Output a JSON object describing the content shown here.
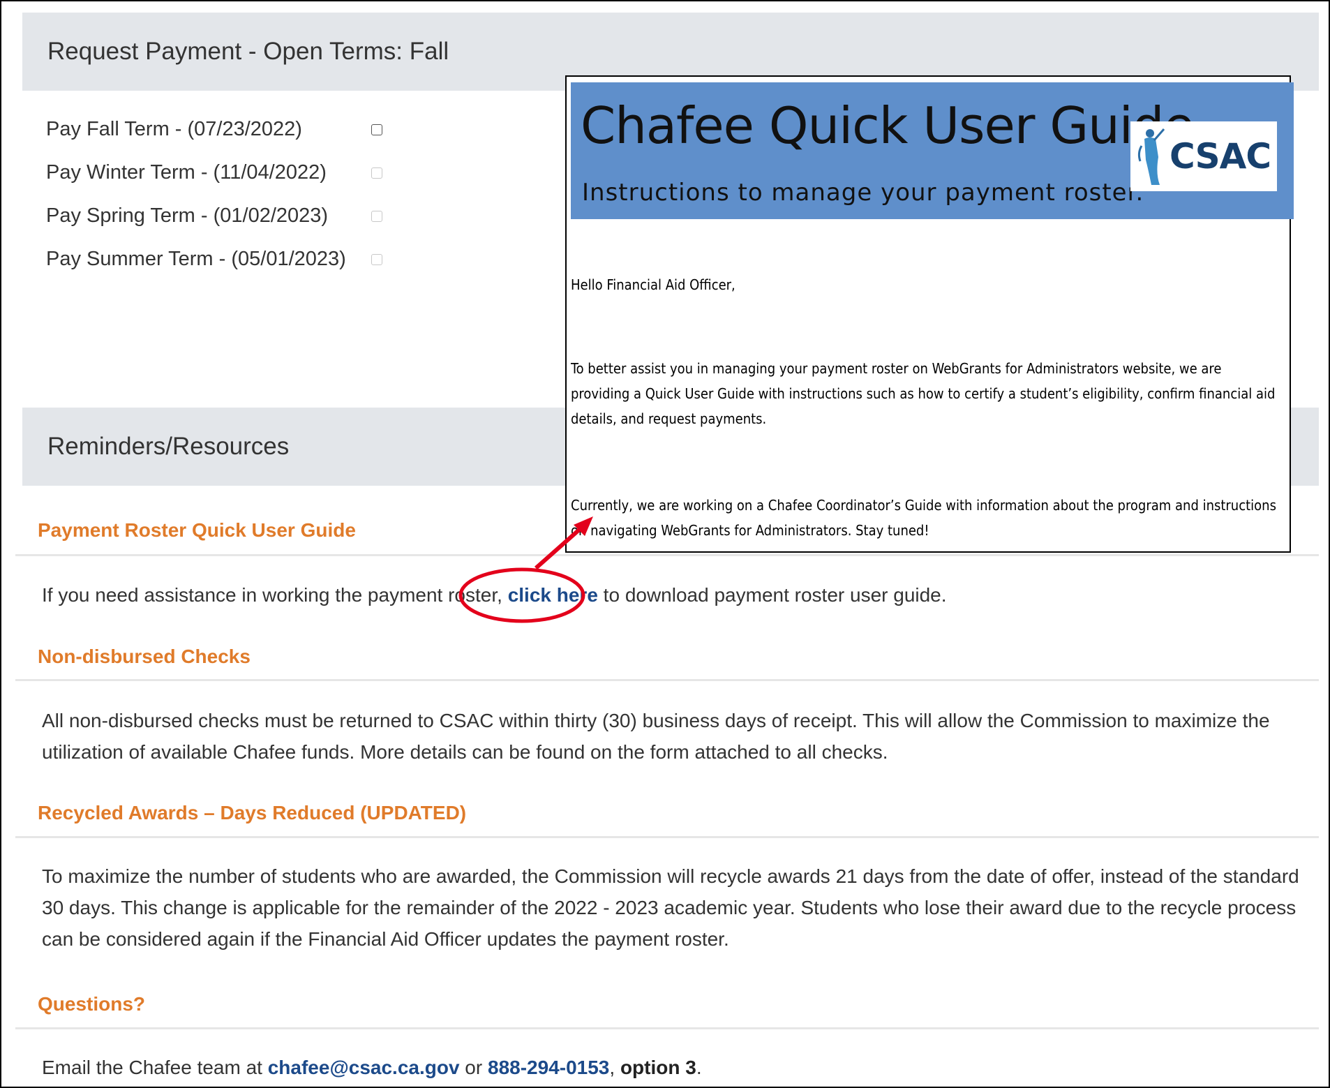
{
  "request_payment": {
    "header": "Request Payment - Open Terms: Fall",
    "terms": [
      {
        "label": "Pay Fall Term - (07/23/2022)",
        "enabled": true
      },
      {
        "label": "Pay Winter Term - (11/04/2022)",
        "enabled": false
      },
      {
        "label": "Pay Spring Term - (01/02/2023)",
        "enabled": false
      },
      {
        "label": "Pay Summer Term - (05/01/2023)",
        "enabled": false
      }
    ]
  },
  "reminders": {
    "header": "Reminders/Resources",
    "payment_roster": {
      "heading": "Payment Roster Quick User Guide",
      "text_before": "If you need assistance in working the payment roster, ",
      "link": "click here",
      "text_after": " to download payment roster user guide."
    },
    "non_disbursed": {
      "heading": "Non-disbursed Checks",
      "text": "All non-disbursed checks must be returned to CSAC within thirty (30) business days of receipt. This will allow the Commission to maximize the utilization of available Chafee funds. More details can be found on the form attached to all checks."
    },
    "recycled": {
      "heading": "Recycled Awards – Days Reduced (UPDATED)",
      "text": "To maximize the number of students who are awarded, the Commission will recycle awards 21 days from the date of offer, instead of the standard 30 days. This change is applicable for the remainder of the 2022 - 2023 academic year. Students who lose their award due to the recycle process can be considered again if the Financial Aid Officer updates the payment roster."
    },
    "questions": {
      "heading": "Questions?",
      "text_before": "Email the Chafee team at ",
      "email": "chafee@csac.ca.gov",
      "text_mid": " or ",
      "phone": "888-294-0153",
      "text_comma": ", ",
      "option": "option 3",
      "text_end": "."
    }
  },
  "guide_popup": {
    "title": "Chafee Quick User Guide",
    "subtitle": "Instructions to manage your payment roster.",
    "logo_text": "CSAC",
    "greeting": "Hello Financial Aid Officer,",
    "paragraph1": "To better assist you in managing your payment roster on WebGrants for Administrators website, we are providing a Quick User Guide with instructions such as how to certify a student’s eligibility, confirm financial aid details, and request payments.",
    "paragraph2": "Currently, we are working on a Chafee Coordinator’s Guide with information about the program and instructions on navigating WebGrants for Administrators. Stay tuned!"
  },
  "colors": {
    "header_bg": "#e3e6ea",
    "accent_orange": "#e07b2a",
    "link_blue": "#1c4a8a",
    "banner_blue": "#5f8fcb",
    "annotation_red": "#e3001b"
  }
}
